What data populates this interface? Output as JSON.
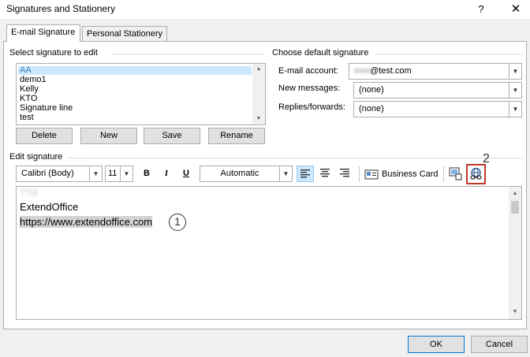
{
  "window": {
    "title": "Signatures and Stationery",
    "help_label": "?",
    "close_label": "✕"
  },
  "tabs": [
    {
      "label": "E-mail Signature",
      "active": true
    },
    {
      "label": "Personal Stationery",
      "active": false
    }
  ],
  "select_group": {
    "label": "Select signature to edit",
    "items": [
      "AA",
      "demo1",
      "Kelly",
      "KTO",
      "Signature line",
      "test"
    ],
    "selected": "AA"
  },
  "list_buttons": {
    "delete": "Delete",
    "new": "New",
    "save": "Save",
    "rename": "Rename"
  },
  "default_group": {
    "label": "Choose default signature",
    "email_account_label": "E-mail account:",
    "email_account_value": "@test.com",
    "new_messages_label": "New messages:",
    "new_messages_value": "(none)",
    "replies_label": "Replies/forwards:",
    "replies_value": "(none)"
  },
  "edit_group": {
    "label": "Edit signature",
    "font_name": "Calibri (Body)",
    "font_size": "11",
    "bold": "B",
    "italic": "I",
    "underline": "U",
    "color": "Automatic",
    "business_card": "Business Card"
  },
  "editor": {
    "line1": "TTM",
    "line2": "ExtendOffice",
    "line3": "https://www.extendoffice.com"
  },
  "callouts": {
    "one": "1",
    "two": "2"
  },
  "footer": {
    "ok": "OK",
    "cancel": "Cancel"
  },
  "colors": {
    "accent": "#0078d7",
    "selection": "#cce8ff",
    "callout_box": "#c0392b"
  }
}
